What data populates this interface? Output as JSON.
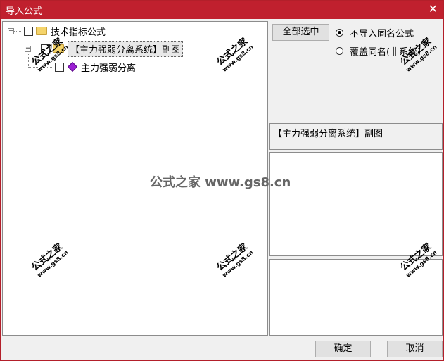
{
  "window": {
    "title": "导入公式",
    "close_glyph": "✕"
  },
  "tree": {
    "root_label": "技术指标公式",
    "group_label": "【主力强弱分离系统】副图",
    "item_label": "主力强弱分离",
    "expander_glyph": "−"
  },
  "options": {
    "select_all_label": "全部选中",
    "radio_skip_label": "不导入同名公式",
    "radio_overwrite_label": "覆盖同名(非系统)",
    "selected": "skip"
  },
  "info": {
    "formula_name": "【主力强弱分离系统】副图"
  },
  "footer": {
    "ok_label": "确定",
    "cancel_label": "取消"
  },
  "watermark": {
    "center_text": "公式之家 www.gs8.cn",
    "stamp_main": "公式之家",
    "stamp_url": "www.gs8.cn"
  }
}
